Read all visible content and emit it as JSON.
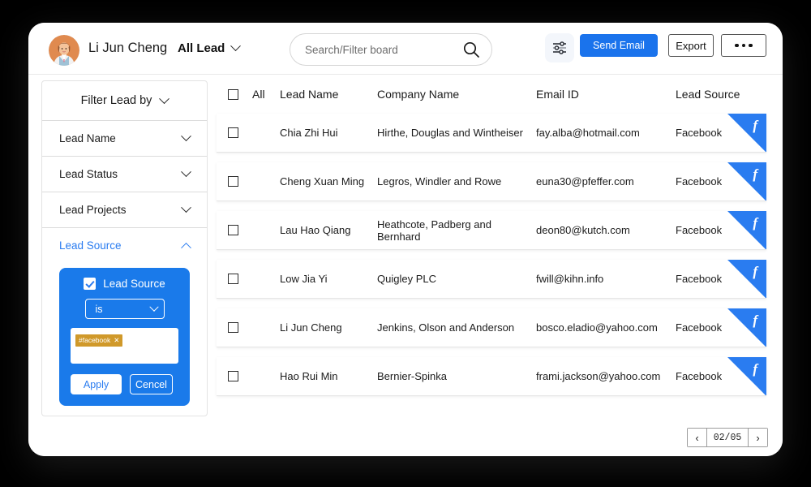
{
  "header": {
    "user_name": "Li Jun Cheng",
    "avatar_icon": "user-avatar",
    "scope_label": "All Lead",
    "scope_chevron_icon": "chevron-down-icon",
    "search": {
      "placeholder": "Search/Filter board",
      "value": "",
      "icon": "search-icon"
    },
    "slider_icon": "sliders-settings-icon",
    "send_email_label": "Send Email",
    "export_label": "Export",
    "more_label": "•••",
    "more_icon": "ellipsis-icon",
    "accent_blue": "#1a73ec"
  },
  "sidebar": {
    "title": "Filter Lead by",
    "title_chevron_icon": "chevron-down-icon",
    "items": [
      {
        "label": "Lead Name",
        "icon": "chevron-down-icon",
        "active": false
      },
      {
        "label": "Lead Status",
        "icon": "chevron-down-icon",
        "active": false
      },
      {
        "label": "Lead Projects",
        "icon": "chevron-down-icon",
        "active": false
      },
      {
        "label": "Lead Source",
        "icon": "chevron-up-icon",
        "active": true
      }
    ],
    "popover": {
      "checkbox_label": "Lead Source",
      "checkbox_checked": true,
      "operator_value": "is",
      "operator_chevron_icon": "chevron-down-icon",
      "tags": [
        {
          "label": "#facebook",
          "remove_icon": "✕",
          "color": "#d0992a"
        }
      ],
      "apply_label": "Apply",
      "cancel_label": "Cencel",
      "background": "#1a7aea"
    }
  },
  "table": {
    "columns": {
      "select_all_label": "All",
      "lead_name": "Lead Name",
      "company_name": "Company Name",
      "email_id": "Email ID",
      "lead_source": "Lead Source"
    },
    "select_all_checked": false,
    "rows": [
      {
        "checked": false,
        "lead_name": "Chia Zhi Hui",
        "company_name": "Hirthe, Douglas and Wintheiser",
        "email_id": "fay.alba@hotmail.com",
        "lead_source": "Facebook",
        "badge_icon": "facebook-icon"
      },
      {
        "checked": false,
        "lead_name": "Cheng Xuan Ming",
        "company_name": "Legros, Windler and Rowe",
        "email_id": "euna30@pfeffer.com",
        "lead_source": "Facebook",
        "badge_icon": "facebook-icon"
      },
      {
        "checked": false,
        "lead_name": "Lau Hao Qiang",
        "company_name": "Heathcote, Padberg and Bernhard",
        "email_id": "deon80@kutch.com",
        "lead_source": "Facebook",
        "badge_icon": "facebook-icon"
      },
      {
        "checked": false,
        "lead_name": "Low Jia Yi",
        "company_name": "Quigley PLC",
        "email_id": "fwill@kihn.info",
        "lead_source": "Facebook",
        "badge_icon": "facebook-icon"
      },
      {
        "checked": false,
        "lead_name": "Li Jun Cheng",
        "company_name": "Jenkins, Olson and Anderson",
        "email_id": "bosco.eladio@yahoo.com",
        "lead_source": "Facebook",
        "badge_icon": "facebook-icon"
      },
      {
        "checked": false,
        "lead_name": "Hao Rui Min",
        "company_name": "Bernier-Spinka",
        "email_id": "frami.jackson@yahoo.com",
        "lead_source": "Facebook",
        "badge_icon": "facebook-icon"
      }
    ],
    "badge_letter": "f",
    "badge_color": "#2a7cf0"
  },
  "pagination": {
    "prev_icon": "chevron-left-icon",
    "next_icon": "chevron-right-icon",
    "prev_label": "‹",
    "next_label": "›",
    "page_label": "02/05"
  }
}
